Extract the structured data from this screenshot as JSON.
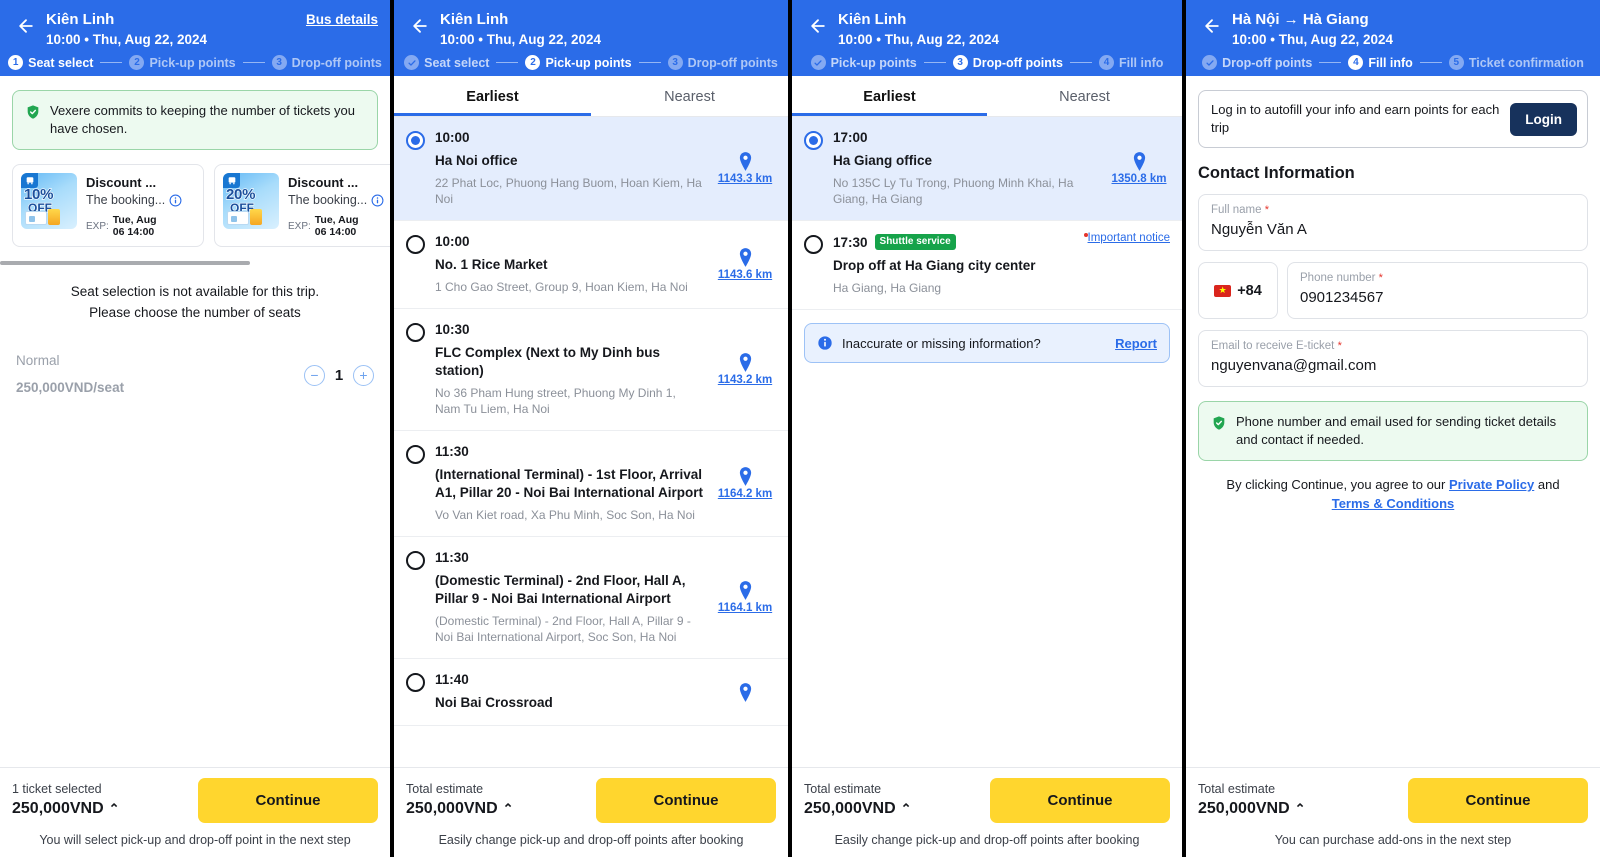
{
  "panel1": {
    "header": {
      "title": "Kiên Linh",
      "subtitle": "10:00 • Thu, Aug 22, 2024",
      "bus_details_label": "Bus details",
      "steps": [
        {
          "num": "1",
          "label": "Seat select",
          "state": "active"
        },
        {
          "num": "2",
          "label": "Pick-up points",
          "state": "todo"
        },
        {
          "num": "3",
          "label": "Drop-off points",
          "state": "todo"
        }
      ]
    },
    "banner": "Vexere commits to keeping the number of tickets you have chosen.",
    "vouchers": [
      {
        "percent": "10%",
        "off": "OFF",
        "title": "Discount ...",
        "desc": "The booking...",
        "exp_key": "EXP:",
        "exp_line1": "Tue, Aug",
        "exp_line2": "06 14:00"
      },
      {
        "percent": "20%",
        "off": "OFF",
        "title": "Discount ...",
        "desc": "The booking...",
        "exp_key": "EXP:",
        "exp_line1": "Tue, Aug",
        "exp_line2": "06 14:00"
      }
    ],
    "seat_note_line1": "Seat selection is not available for this trip.",
    "seat_note_line2": "Please choose the number of seats",
    "fare": {
      "type": "Normal",
      "price": "250,000VND/seat",
      "minus": "−",
      "plus": "+",
      "quantity": "1"
    },
    "footer": {
      "label": "1 ticket selected",
      "total": "250,000VND",
      "caret": "⌃",
      "continue_label": "Continue",
      "note": "You will select pick-up and drop-off point in the next step"
    }
  },
  "panel2": {
    "header": {
      "title": "Kiên Linh",
      "subtitle": "10:00 • Thu, Aug 22, 2024",
      "steps": [
        {
          "num": "✓",
          "label": "Seat select",
          "state": "done"
        },
        {
          "num": "2",
          "label": "Pick-up points",
          "state": "active"
        },
        {
          "num": "3",
          "label": "Drop-off points",
          "state": "todo"
        }
      ]
    },
    "tabs": [
      {
        "label": "Earliest",
        "selected": true
      },
      {
        "label": "Nearest",
        "selected": false
      }
    ],
    "points": [
      {
        "time": "10:00",
        "name": "Ha Noi office",
        "address": "22 Phat Loc, Phuong Hang Buom, Hoan Kiem, Ha Noi",
        "distance": "1143.3 km",
        "selected": true
      },
      {
        "time": "10:00",
        "name": "No. 1 Rice Market",
        "address": "1 Cho Gao Street, Group 9, Hoan Kiem, Ha Noi",
        "distance": "1143.6 km",
        "selected": false
      },
      {
        "time": "10:30",
        "name": "FLC Complex (Next to My Dinh bus station)",
        "address": "No 36 Pham Hung street, Phuong My Dinh 1, Nam Tu Liem, Ha Noi",
        "distance": "1143.2 km",
        "selected": false
      },
      {
        "time": "11:30",
        "name": "(International Terminal) - 1st Floor, Arrival A1, Pillar 20 - Noi Bai International Airport",
        "address": "Vo Van Kiet road, Xa Phu Minh, Soc Son, Ha Noi",
        "distance": "1164.2 km",
        "selected": false
      },
      {
        "time": "11:30",
        "name": "(Domestic Terminal) - 2nd Floor, Hall A, Pillar 9 - Noi Bai International Airport",
        "address": "(Domestic Terminal) - 2nd Floor, Hall A, Pillar 9 - Noi Bai International Airport, Soc Son, Ha Noi",
        "distance": "1164.1 km",
        "selected": false
      },
      {
        "time": "11:40",
        "name": "Noi Bai Crossroad",
        "address": "",
        "distance": "",
        "selected": false
      }
    ],
    "footer": {
      "label": "Total estimate",
      "total": "250,000VND",
      "caret": "⌃",
      "continue_label": "Continue",
      "note": "Easily change pick-up and drop-off points after booking"
    }
  },
  "panel3": {
    "header": {
      "title": "Kiên Linh",
      "subtitle": "10:00 • Thu, Aug 22, 2024",
      "steps": [
        {
          "num": "✓",
          "label": "Pick-up points",
          "state": "done"
        },
        {
          "num": "3",
          "label": "Drop-off points",
          "state": "active"
        },
        {
          "num": "4",
          "label": "Fill info",
          "state": "todo"
        }
      ]
    },
    "tabs": [
      {
        "label": "Earliest",
        "selected": true
      },
      {
        "label": "Nearest",
        "selected": false
      }
    ],
    "points": [
      {
        "time": "17:00",
        "name": "Ha Giang office",
        "address": "No 135C Ly Tu Trong, Phuong Minh Khai, Ha Giang, Ha Giang",
        "distance": "1350.8 km",
        "selected": true,
        "badge": "",
        "notice": ""
      },
      {
        "time": "17:30",
        "name": "Drop off at Ha Giang city center",
        "address": "Ha Giang, Ha Giang",
        "distance": "",
        "selected": false,
        "badge": "Shuttle service",
        "notice": "Important notice"
      }
    ],
    "report": {
      "text": "Inaccurate or missing information?",
      "link": "Report"
    },
    "footer": {
      "label": "Total estimate",
      "total": "250,000VND",
      "caret": "⌃",
      "continue_label": "Continue",
      "note": "Easily change pick-up and drop-off points after booking"
    }
  },
  "panel4": {
    "header": {
      "title": "Hà Nội → Hà Giang",
      "subtitle": "10:00 • Thu, Aug 22, 2024",
      "steps": [
        {
          "num": "✓",
          "label": "Drop-off points",
          "state": "done"
        },
        {
          "num": "4",
          "label": "Fill info",
          "state": "active"
        },
        {
          "num": "5",
          "label": "Ticket confirmation",
          "state": "todo"
        }
      ]
    },
    "login": {
      "text": "Log in to autofill your info and earn points for each trip",
      "button": "Login"
    },
    "section_title": "Contact Information",
    "fields": {
      "fullname": {
        "label": "Full name",
        "required": "*",
        "value": "Nguyễn Văn A"
      },
      "country_code": "+84",
      "phone": {
        "label": "Phone number",
        "required": "*",
        "value": "0901234567"
      },
      "email": {
        "label": "Email to receive E-ticket",
        "required": "*",
        "value": "nguyenvana@gmail.com"
      }
    },
    "green_note": "Phone number and email used for sending ticket details and contact if needed.",
    "policy": {
      "prefix": "By clicking Continue, you agree to our ",
      "link1": "Private Policy",
      "mid": " and ",
      "link2": "Terms & Conditions"
    },
    "footer": {
      "label": "Total estimate",
      "total": "250,000VND",
      "caret": "⌃",
      "continue_label": "Continue",
      "note": "You can purchase add-ons in the next step"
    }
  }
}
